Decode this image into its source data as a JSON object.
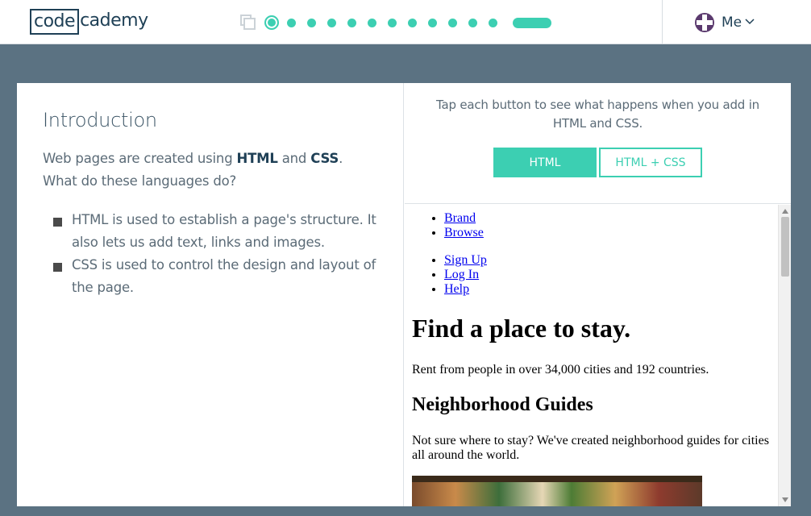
{
  "header": {
    "logo_text_boxed": "code",
    "logo_text_rest": "cademy",
    "user_label": "Me"
  },
  "progress": {
    "total_steps": 13,
    "current_step": 1,
    "accent_color": "#3ccfb2"
  },
  "lesson": {
    "title": "Introduction",
    "intro_prefix": "Web pages are created using ",
    "intro_html": "HTML",
    "intro_and": " and ",
    "intro_css": "CSS",
    "intro_suffix": ". What do these languages do?",
    "bullets": [
      "HTML is used to establish a page's structure. It also lets us add text, links and images.",
      "CSS is used to control the design and layout of the page."
    ]
  },
  "demo": {
    "instruction": "Tap each button to see what happens when you add in HTML and CSS.",
    "button_html": "HTML",
    "button_html_css": "HTML + CSS",
    "active_button": "HTML"
  },
  "preview": {
    "nav1": [
      "Brand",
      "Browse"
    ],
    "nav2": [
      "Sign Up",
      "Log In",
      "Help"
    ],
    "heading": "Find a place to stay.",
    "tagline": "Rent from people in over 34,000 cities and 192 countries.",
    "subheading": "Neighborhood Guides",
    "guides_text": "Not sure where to stay? We've created neighborhood guides for cities all around the world."
  }
}
